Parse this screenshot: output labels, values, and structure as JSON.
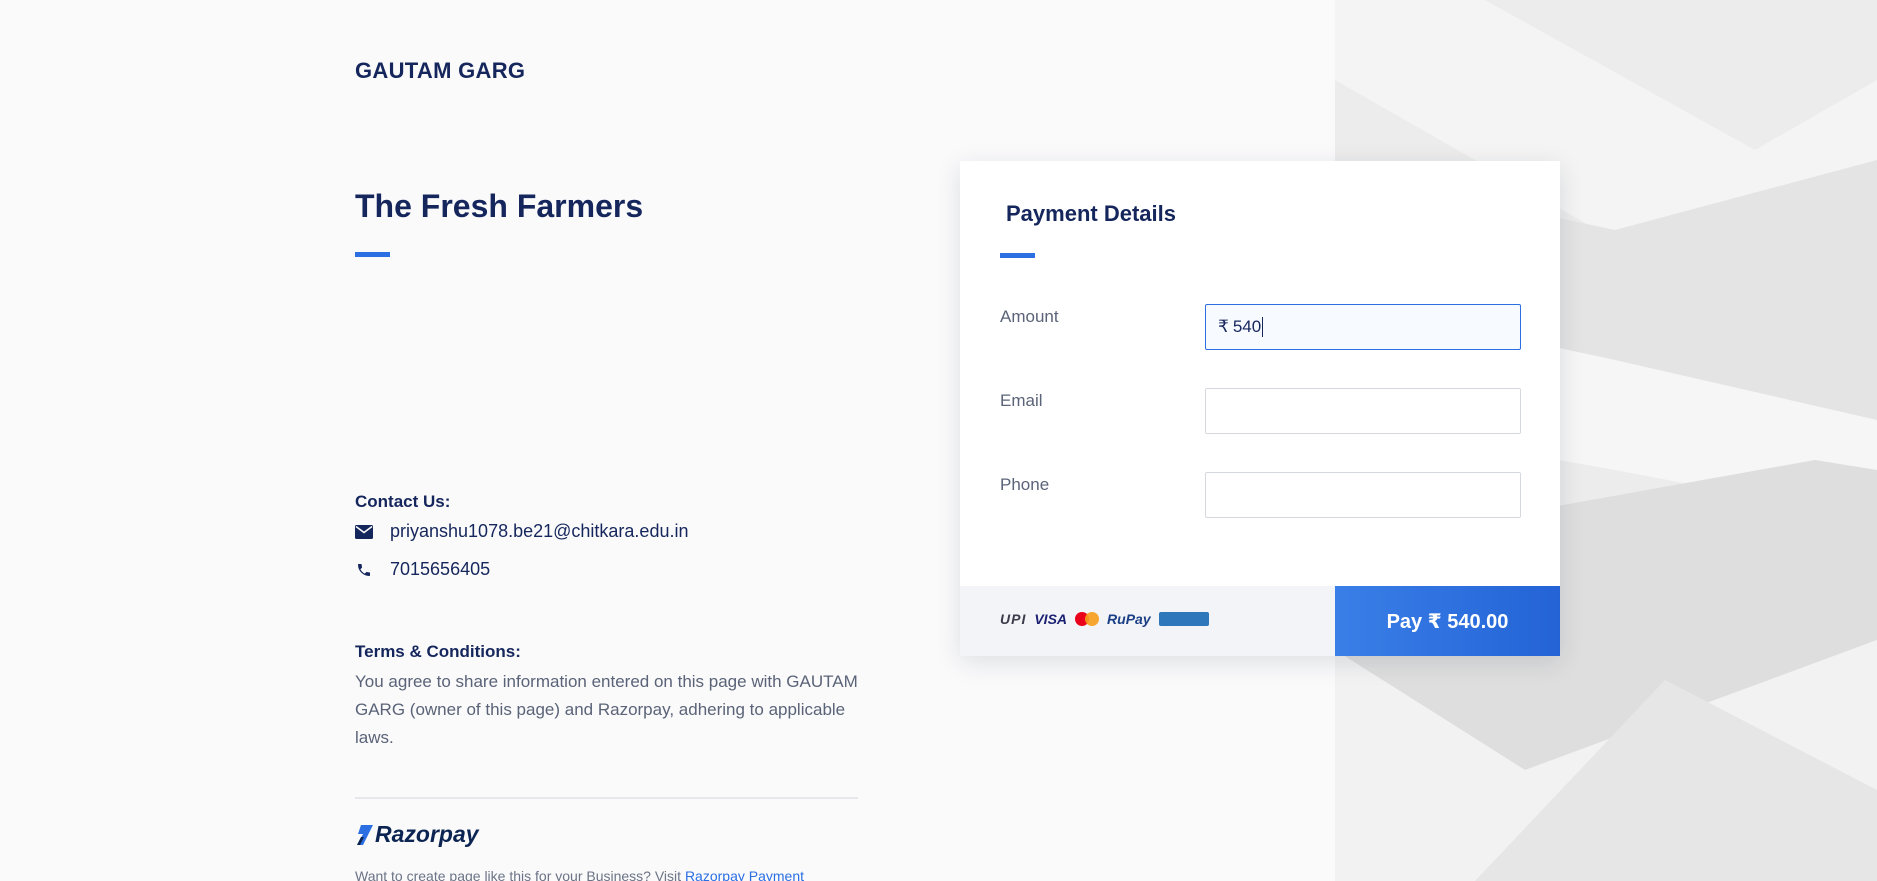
{
  "merchant_name": "GAUTAM GARG",
  "page_title": "The Fresh Farmers",
  "contact": {
    "heading": "Contact Us:",
    "email": "priyanshu1078.be21@chitkara.edu.in",
    "phone": "7015656405"
  },
  "terms": {
    "heading": "Terms & Conditions:",
    "text": "You agree to share information entered on this page with GAUTAM GARG (owner of this page) and Razorpay, adhering to applicable laws."
  },
  "branding": {
    "logo_text": "Razorpay",
    "footer_prefix": "Want to create page like this for your Business? Visit ",
    "footer_link": "Razorpay Payment"
  },
  "payment": {
    "title": "Payment Details",
    "fields": {
      "amount": {
        "label": "Amount",
        "currency": "₹",
        "value": "540"
      },
      "email": {
        "label": "Email",
        "value": ""
      },
      "phone": {
        "label": "Phone",
        "value": ""
      }
    },
    "methods": [
      "UPI",
      "VISA",
      "Mastercard",
      "RuPay",
      "American Express"
    ],
    "pay_button": "Pay  ₹ 540.00"
  },
  "colors": {
    "accent": "#2b6fe3",
    "text_dark": "#15265c",
    "background": "#fafafb"
  }
}
